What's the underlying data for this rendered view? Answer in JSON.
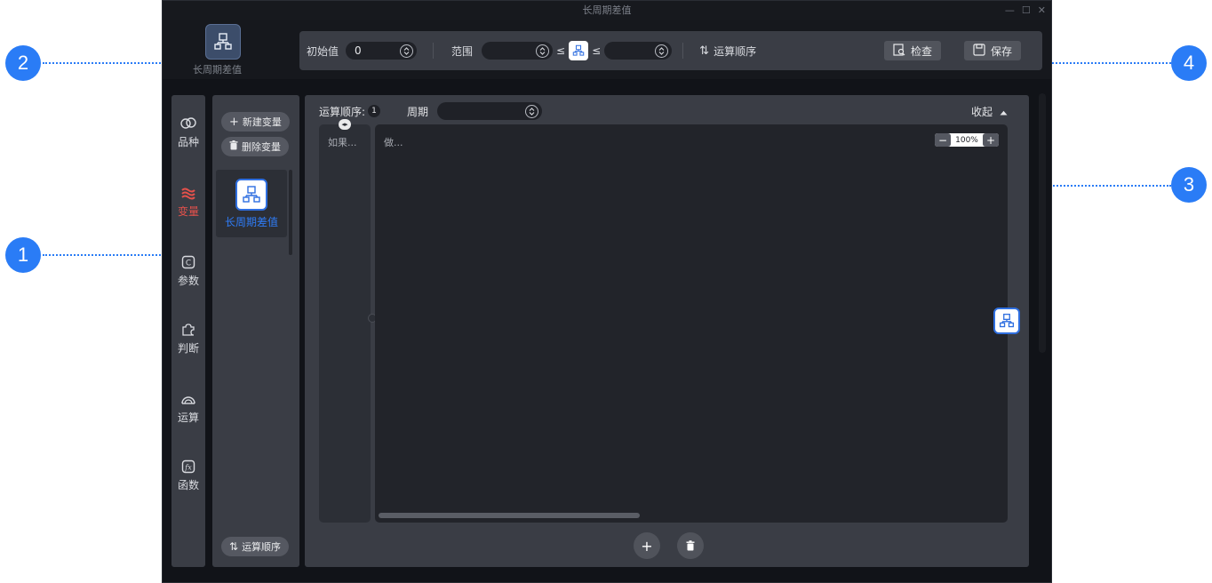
{
  "window": {
    "title": "长周期差值",
    "controls": [
      "—",
      "☐",
      "✕"
    ]
  },
  "header": {
    "logo_label": "长周期差值"
  },
  "toolbar": {
    "initial_label": "初始值",
    "initial_value": "0",
    "range_label": "范围",
    "range_min": "",
    "range_max": "",
    "le_symbol": "≤",
    "order_label": "运算顺序",
    "check_label": "检查",
    "save_label": "保存"
  },
  "nav": {
    "items": [
      {
        "label": "品种",
        "icon": "coins-icon"
      },
      {
        "label": "变量",
        "icon": "waves-icon",
        "active": true
      },
      {
        "label": "参数",
        "icon": "param-c-icon"
      },
      {
        "label": "判断",
        "icon": "puzzle-icon"
      },
      {
        "label": "运算",
        "icon": "gauge-icon"
      },
      {
        "label": "函数",
        "icon": "function-icon"
      }
    ]
  },
  "variables": {
    "new_label": "新建变量",
    "delete_label": "删除变量",
    "items": [
      {
        "label": "长周期差值",
        "selected": true
      }
    ],
    "order_label": "运算顺序"
  },
  "main": {
    "order_label": "运算顺序:",
    "order_value": "1",
    "period_label": "周期",
    "period_value": "",
    "collapse_label": "收起",
    "if_label": "如果...",
    "do_label": "做...",
    "zoom_value": "100%",
    "zoom_minus": "−",
    "zoom_plus": "+"
  },
  "annotations": {
    "c1": "1",
    "c2": "2",
    "c3": "3",
    "c4": "4"
  },
  "colors": {
    "accent": "#2a7cf6",
    "active_nav": "#e4514b",
    "panel": "#3a3d45",
    "canvas": "#22242a"
  }
}
